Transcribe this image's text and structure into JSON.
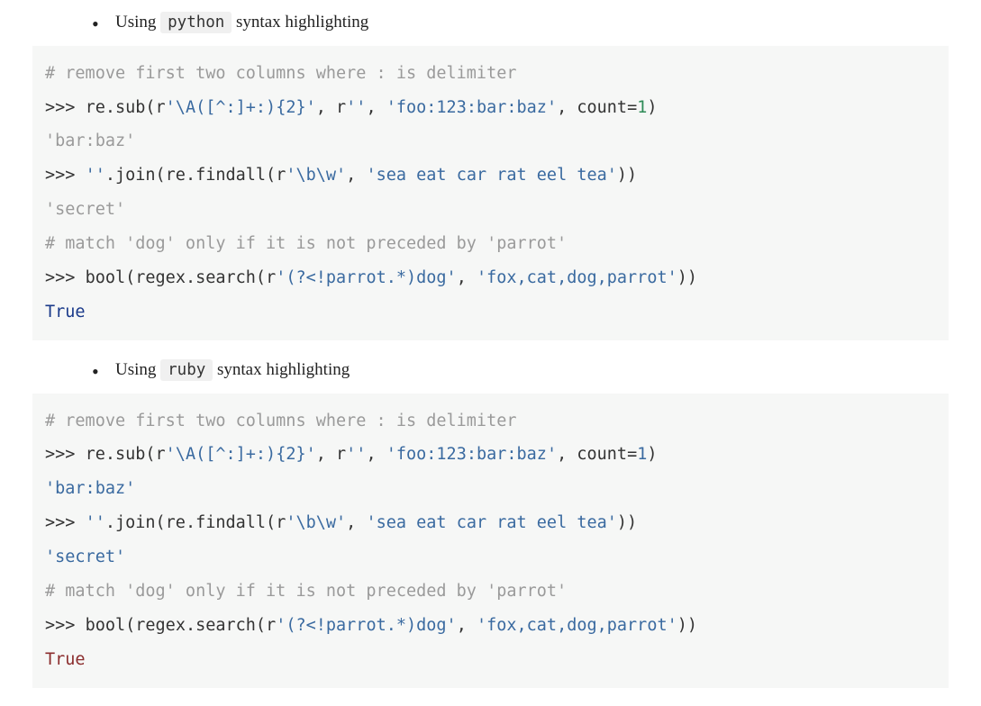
{
  "sections": [
    {
      "label_before": "Using ",
      "lang_tag": "python",
      "label_after": " syntax highlighting",
      "style": "py"
    },
    {
      "label_before": "Using ",
      "lang_tag": "ruby",
      "label_after": " syntax highlighting",
      "style": "rb"
    }
  ],
  "code": {
    "comment1": "# remove first two columns where : is delimiter",
    "line1_prompt": ">>> ",
    "line1_a": "re.sub(",
    "line1_r1_pre": "r",
    "line1_r1": "'\\A([^:]+:){2}'",
    "line1_comma1": ", ",
    "line1_r2_pre": "r",
    "line1_r2": "''",
    "line1_comma2": ", ",
    "line1_s3": "'foo:123:bar:baz'",
    "line1_comma3": ", ",
    "line1_kw": "count",
    "line1_eq": "=",
    "line1_num": "1",
    "line1_close": ")",
    "out1": "'bar:baz'",
    "line2_prompt": ">>> ",
    "line2_a": "''",
    "line2_b": ".join(re.findall(",
    "line2_r1_pre": "r",
    "line2_r1": "'\\b\\w'",
    "line2_comma": ", ",
    "line2_s2": "'sea eat car rat eel tea'",
    "line2_close": "))",
    "out2": "'secret'",
    "comment2": "# match 'dog' only if it is not preceded by 'parrot'",
    "line3_prompt": ">>> ",
    "line3_a": "bool",
    "line3_b": "(regex.search(",
    "line3_r1_pre": "r",
    "line3_r1": "'(?<!parrot.*)dog'",
    "line3_comma": ", ",
    "line3_s2": "'fox,cat,dog,parrot'",
    "line3_close": "))",
    "out3": "True"
  }
}
